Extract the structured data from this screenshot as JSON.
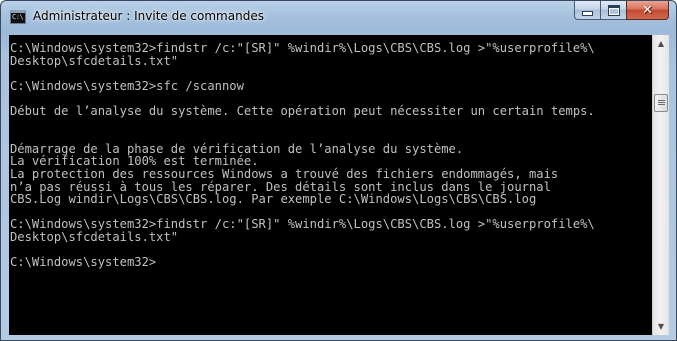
{
  "window": {
    "title": "Administrateur : Invite de commandes",
    "app_icon_text": "C:\\"
  },
  "caption_buttons": {
    "minimize_icon": "minimize-icon",
    "maximize_icon": "maximize-icon",
    "close_icon": "close-icon",
    "close_glyph": "✕"
  },
  "console": {
    "background": "#000000",
    "foreground": "#c0c0c0",
    "lines": [
      "C:\\Windows\\system32>findstr /c:\"[SR]\" %windir%\\Logs\\CBS\\CBS.log >\"%userprofile%\\",
      "Desktop\\sfcdetails.txt\"",
      "",
      "C:\\Windows\\system32>sfc /scannow",
      "",
      "Début de l’analyse du système. Cette opération peut nécessiter un certain temps.",
      "",
      "",
      "Démarrage de la phase de vérification de l’analyse du système.",
      "La vérification 100% est terminée.",
      "La protection des ressources Windows a trouvé des fichiers endommagés, mais",
      "n’a pas réussi à tous les réparer. Des détails sont inclus dans le journal",
      "CBS.Log windir\\Logs\\CBS\\CBS.log. Par exemple C:\\Windows\\Logs\\CBS\\CBS.log",
      "",
      "C:\\Windows\\system32>findstr /c:\"[SR]\" %windir%\\Logs\\CBS\\CBS.log >\"%userprofile%\\",
      "Desktop\\sfcdetails.txt\"",
      "",
      "C:\\Windows\\system32>"
    ]
  },
  "scrollbar": {
    "up_arrow": "▲",
    "down_arrow": "▼",
    "position_fraction": 0.17
  }
}
